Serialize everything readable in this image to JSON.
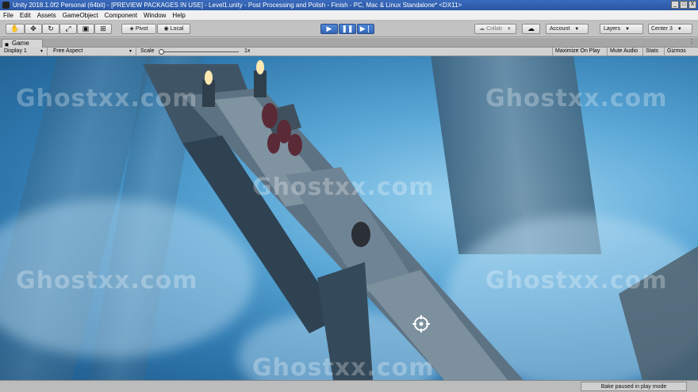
{
  "window": {
    "title": "Unity 2018.1.0f2 Personal (64bit) - [PREVIEW PACKAGES IN USE] - Level1.unity - Post Processing and Polish - Finish - PC, Mac & Linux Standalone* <DX11>",
    "minimize": "_",
    "maximize": "□",
    "close": "X"
  },
  "menu": [
    "File",
    "Edit",
    "Assets",
    "GameObject",
    "Component",
    "Window",
    "Help"
  ],
  "toolbar": {
    "pivot": "Pivot",
    "local": "Local",
    "collab": "Collab",
    "account": "Account",
    "layers": "Layers",
    "layout": "Center 3",
    "play_icon": "play-icon",
    "pause_icon": "pause-icon",
    "step_icon": "step-icon",
    "play_active": true,
    "pause_active": true,
    "accent": "#3a6fc4"
  },
  "tab": {
    "label": "Game"
  },
  "gamebar": {
    "display": "Display 1",
    "aspect": "Free Aspect",
    "scale_label": "Scale",
    "scale_value": "1x",
    "scale_fraction": 0.0,
    "maximize_on_play": "Maximize On Play",
    "mute_audio": "Mute Audio",
    "stats": "Stats",
    "gizmos": "Gizmos"
  },
  "watermarks": [
    "Ghostxx.com",
    "Ghostxx.com",
    "Ghostxx.com",
    "Ghostxx.com",
    "Ghostxx.com",
    "Ghostxx.com"
  ],
  "status": {
    "message": "Bake paused in play mode"
  }
}
